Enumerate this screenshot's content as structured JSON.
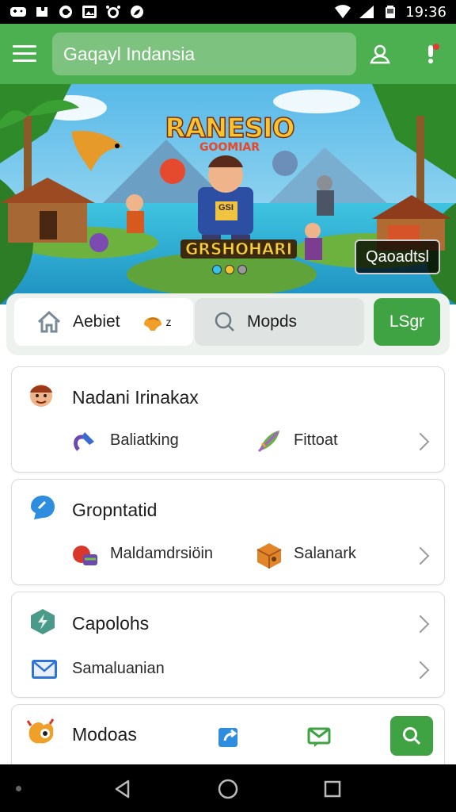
{
  "status_bar": {
    "time": "19:36"
  },
  "app_bar": {
    "search_text": "Gaqayl Indansia"
  },
  "banner": {
    "title_line1": "RANESIO",
    "title_line2": "GOOMIAR",
    "tagline": "GRSHOHARI",
    "caption": "Qaoadtsl",
    "shirt_text": "GSI"
  },
  "quick_bar": {
    "home_label": "Aebiet",
    "home_suffix": "z",
    "search_label": "Mopds",
    "green_label": "LSgr"
  },
  "cards": [
    {
      "title": "Nadani Irinakax",
      "items": [
        "Baliatking",
        "Fittoat"
      ]
    },
    {
      "title": "Gropntatid",
      "items": [
        "Maldamdrsiöin",
        "Salanark"
      ]
    },
    {
      "title": "Capolohs",
      "subtitle": "Samaluanian"
    },
    {
      "title": "Modoas"
    }
  ],
  "colors": {
    "primary_green": "#4caf50",
    "dark_green": "#3fa243",
    "status_bar": "#000000"
  }
}
